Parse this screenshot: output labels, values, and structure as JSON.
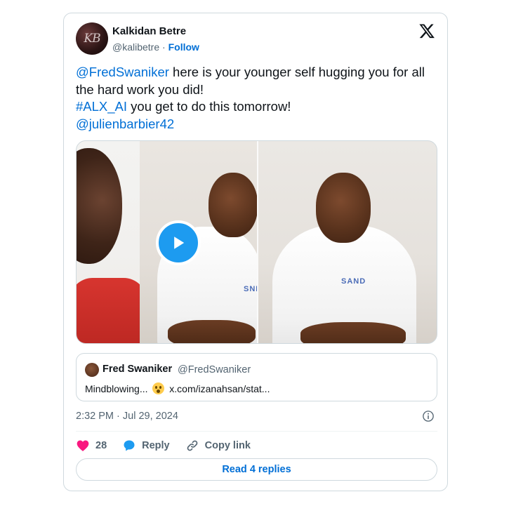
{
  "author": {
    "name": "Kalkidan Betre",
    "avatar_monogram": "KB",
    "handle": "@kalibetre",
    "separator": "·",
    "follow_label": "Follow"
  },
  "brand_icon": "x-logo-icon",
  "tweet": {
    "mention_1": "@FredSwaniker",
    "line_1_rest": " here is your younger self hugging you for all the hard work you did!",
    "hashtag": "#ALX_AI",
    "line_2_rest": " you get to do this tomorrow!",
    "mention_2": "@julienbarbier42"
  },
  "media": {
    "shirt_logo_left": "SND",
    "shirt_logo_right": "SAND",
    "play_icon": "play-icon"
  },
  "quote": {
    "name": "Fred Swaniker",
    "handle": "@FredSwaniker",
    "text_before": "Mindblowing...",
    "emoji": "surprised-face-emoji",
    "link": "x.com/izanahsan/stat..."
  },
  "meta": {
    "timestamp": "2:32 PM · Jul 29, 2024",
    "info_icon": "info-icon"
  },
  "actions": {
    "like_count": "28",
    "reply_label": "Reply",
    "copy_link_label": "Copy link"
  },
  "read_replies_label": "Read 4 replies",
  "colors": {
    "link_blue": "#006fd6",
    "play_blue": "#1d9bf0",
    "heart_pink": "#f91880",
    "muted": "#536471",
    "border": "#cfd9de"
  }
}
